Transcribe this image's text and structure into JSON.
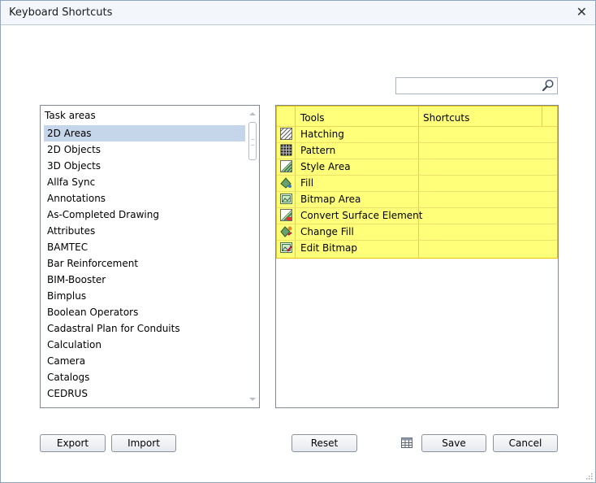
{
  "window": {
    "title": "Keyboard Shortcuts",
    "close_glyph": "✕"
  },
  "search": {
    "value": "",
    "placeholder": "",
    "icon": "search-icon"
  },
  "task_areas": {
    "header": "Task areas",
    "selected": "2D Areas",
    "items": [
      "2D Areas",
      "2D Objects",
      "3D Objects",
      "Allfa Sync",
      "Annotations",
      "As-Completed Drawing",
      "Attributes",
      "BAMTEC",
      "Bar Reinforcement",
      "BIM-Booster",
      "Bimplus",
      "Boolean Operators",
      "Cadastral Plan for Conduits",
      "Calculation",
      "Camera",
      "Catalogs",
      "CEDRUS"
    ]
  },
  "tools_table": {
    "headers": {
      "tools": "Tools",
      "shortcuts": "Shortcuts"
    },
    "highlight_color": "#ffff7a",
    "rows": [
      {
        "tool": "Hatching",
        "shortcut": "",
        "icon": "hatching-icon"
      },
      {
        "tool": "Pattern",
        "shortcut": "",
        "icon": "pattern-icon"
      },
      {
        "tool": "Style Area",
        "shortcut": "",
        "icon": "style-area-icon"
      },
      {
        "tool": "Fill",
        "shortcut": "",
        "icon": "fill-icon"
      },
      {
        "tool": "Bitmap Area",
        "shortcut": "",
        "icon": "bitmap-area-icon"
      },
      {
        "tool": "Convert Surface Element",
        "shortcut": "",
        "icon": "convert-surface-element-icon"
      },
      {
        "tool": "Change Fill",
        "shortcut": "",
        "icon": "change-fill-icon"
      },
      {
        "tool": "Edit Bitmap",
        "shortcut": "",
        "icon": "edit-bitmap-icon"
      }
    ]
  },
  "buttons": {
    "export": "Export",
    "import": "Import",
    "reset": "Reset",
    "save": "Save",
    "cancel": "Cancel"
  }
}
